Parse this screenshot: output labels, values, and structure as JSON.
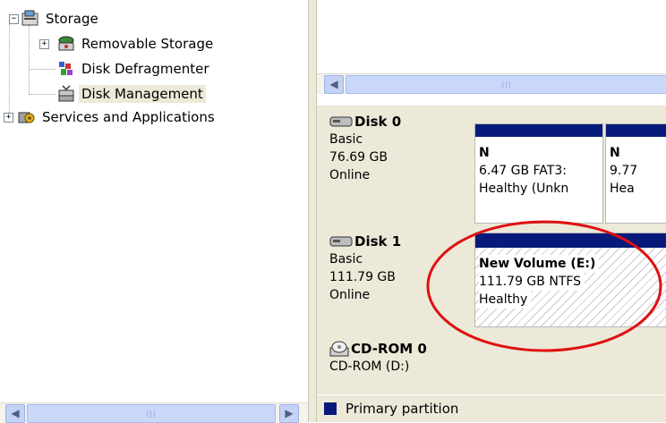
{
  "tree": {
    "items": [
      {
        "label": "Storage",
        "expander": "⊟",
        "icon": "storage-icon"
      },
      {
        "label": "Removable Storage",
        "expander": "+",
        "icon": "removable-storage-icon"
      },
      {
        "label": "Disk Defragmenter",
        "icon": "defragmenter-icon"
      },
      {
        "label": "Disk Management",
        "icon": "disk-management-icon",
        "selected": true
      },
      {
        "label": "Services and Applications",
        "expander": "+",
        "icon": "services-icon"
      }
    ]
  },
  "disks": [
    {
      "name": "Disk 0",
      "type": "Basic",
      "size": "76.69 GB",
      "status": "Online",
      "partitions": [
        {
          "line1": "N",
          "line2": "6.47 GB FAT3:",
          "line3": "Healthy (Unkn"
        },
        {
          "line1": "N",
          "line2": "9.77",
          "line3": "Hea"
        }
      ]
    },
    {
      "name": "Disk 1",
      "type": "Basic",
      "size": "111.79 GB",
      "status": "Online",
      "partitions": [
        {
          "line1": "New Volume  (E:)",
          "line2": "111.79 GB NTFS",
          "line3": "Healthy"
        }
      ]
    },
    {
      "name": "CD-ROM 0",
      "type": "CD-ROM (D:)"
    }
  ],
  "legend": {
    "label": "Primary partition",
    "color": "#071a7a"
  },
  "colors": {
    "highlight_circle": "#e01010",
    "partition_bar": "#071a7a"
  }
}
